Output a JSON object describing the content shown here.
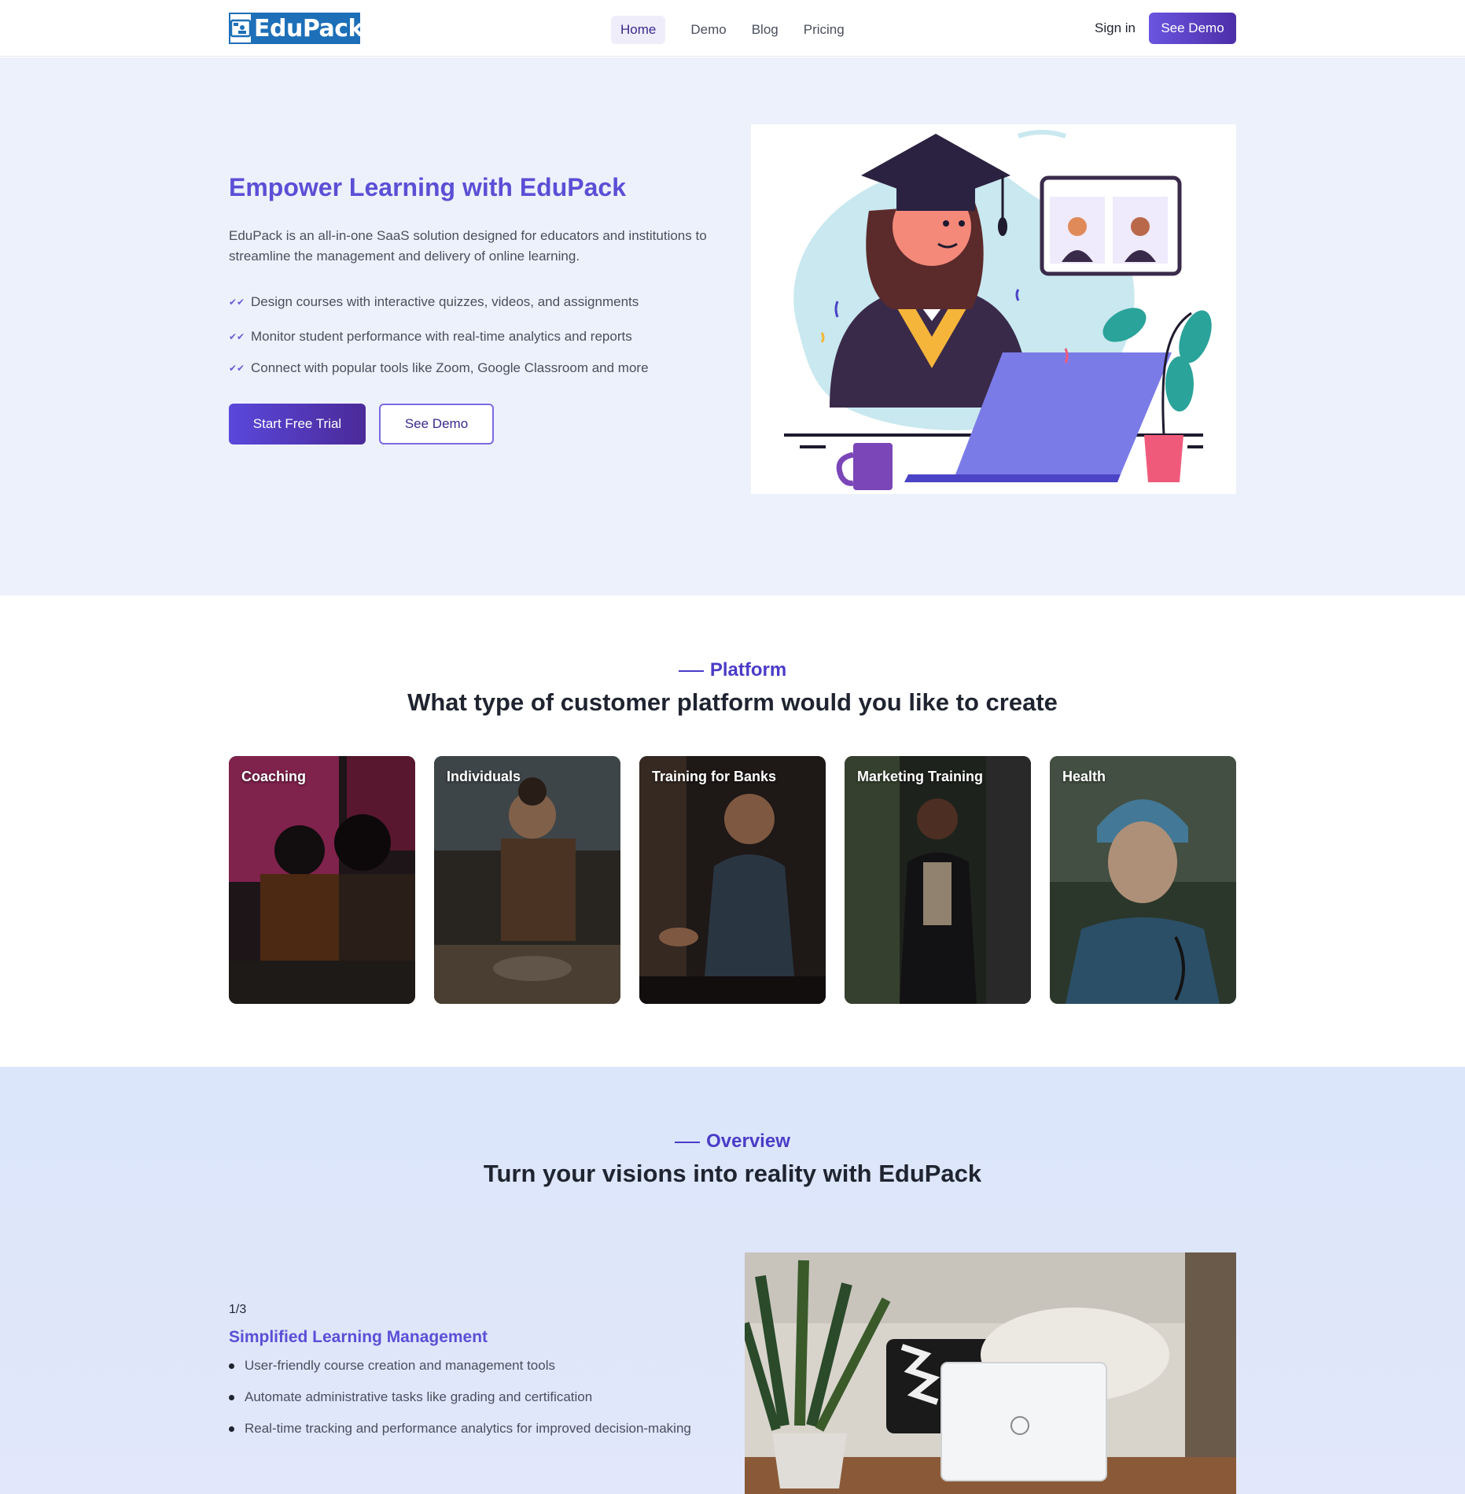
{
  "nav": {
    "logo_text": "EduPack",
    "links": [
      "Home",
      "Demo",
      "Blog",
      "Pricing"
    ],
    "signin": "Sign in",
    "cta": "See Demo"
  },
  "hero": {
    "title": "Empower Learning with EduPack",
    "description": "EduPack is an all-in-one SaaS solution designed for educators and institutions to streamline the management and delivery of online learning.",
    "features": [
      "Design courses with interactive quizzes, videos, and assignments",
      "Monitor student performance with real-time analytics and reports",
      "Connect with popular tools like Zoom, Google Classroom and more"
    ],
    "primary_button": "Start Free Trial",
    "secondary_button": "See Demo"
  },
  "platform": {
    "eyebrow": "Platform",
    "title": "What type of customer platform would you like to create",
    "cards": [
      "Coaching",
      "Individuals",
      "Training for Banks",
      "Marketing Training",
      "Health"
    ]
  },
  "overview": {
    "eyebrow": "Overview",
    "title": "Turn your visions into reality with EduPack",
    "counter": "1/3",
    "feature_title": "Simplified Learning Management",
    "bullets": [
      "User-friendly course creation and management tools",
      "Automate administrative tasks like grading and certification",
      "Real-time tracking and performance analytics for improved decision-making"
    ]
  },
  "colors": {
    "accent": "#5b4fd6",
    "brand_blue": "#1d6fb8",
    "hero_bg": "#edf1fc",
    "overview_bg": "#dbe6fa"
  }
}
